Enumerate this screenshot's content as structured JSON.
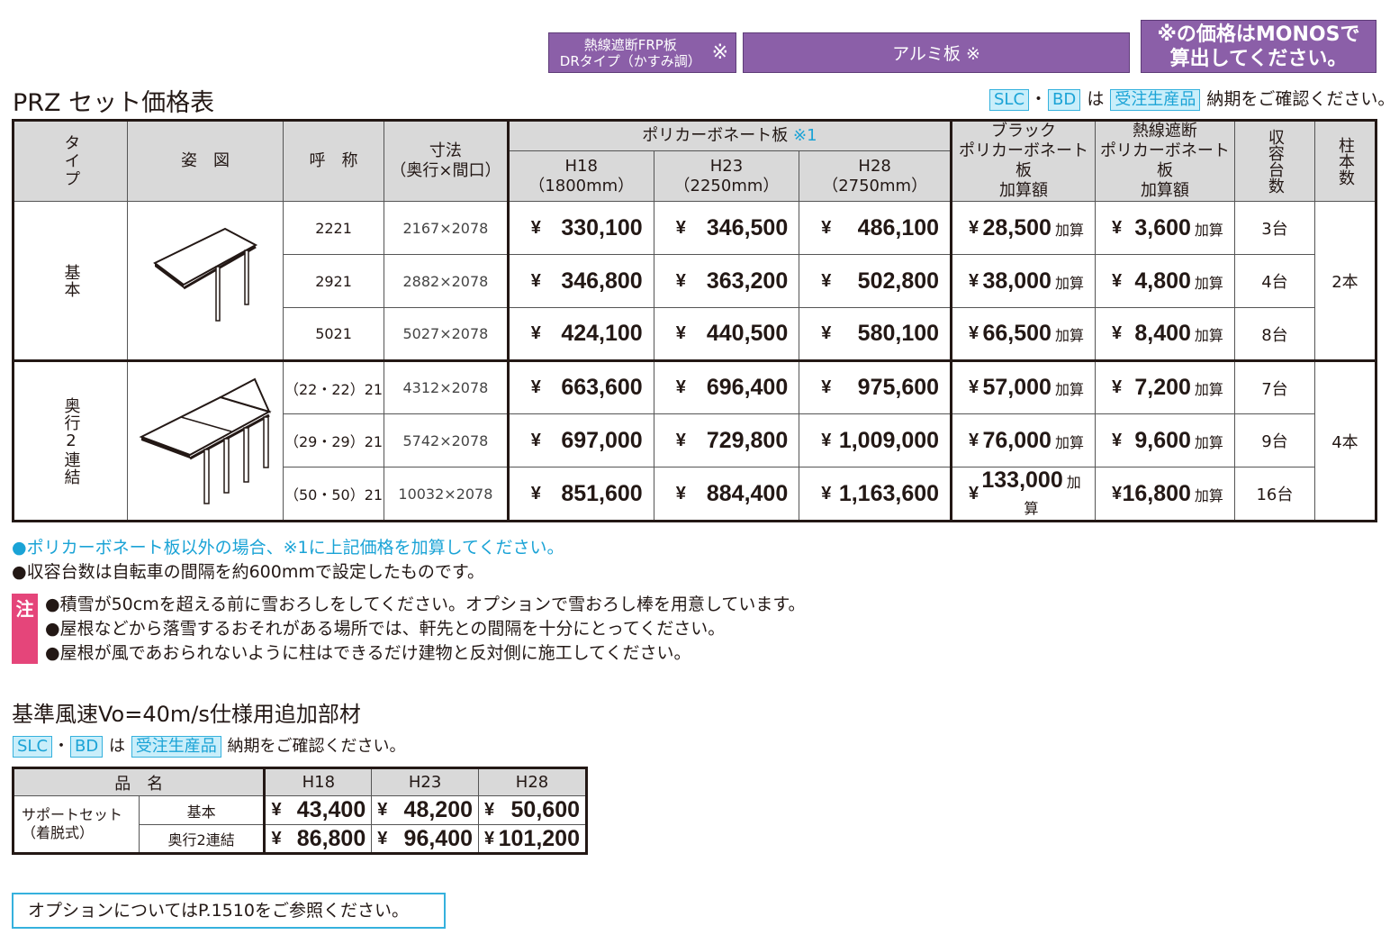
{
  "top_boxes": {
    "box1_line1": "熱線遮断FRP板",
    "box1_line2": "DRタイプ（かすみ調）",
    "box1_mark": "※",
    "box2": "アルミ板 ※",
    "box3_line1": "※の価格はMONOSで",
    "box3_line2": "算出してください。"
  },
  "title": "PRZ セット価格表",
  "notice": {
    "tag1": "SLC",
    "dot": "・",
    "tag2": "BD",
    "wa": "は",
    "tag3": "受注生産品",
    "text": "納期をご確認ください。"
  },
  "table": {
    "headers": {
      "type": "タイプ",
      "figure": "姿　図",
      "name": "呼　称",
      "dim_line1": "寸法",
      "dim_line2": "（奥行×間口）",
      "poly": "ポリカーボネート板",
      "poly_mark": "※1",
      "h18": "H18",
      "h18_mm": "（1800mm）",
      "h23": "H23",
      "h23_mm": "（2250mm）",
      "h28": "H28",
      "h28_mm": "（2750mm）",
      "black_l1": "ブラック",
      "black_l2": "ポリカーボネート板",
      "black_l3": "加算額",
      "heat_l1": "熱線遮断",
      "heat_l2": "ポリカーボネート板",
      "heat_l3": "加算額",
      "capacity": "収容台数",
      "posts": "柱本数"
    },
    "yen": "¥",
    "add": "加算",
    "groups": [
      {
        "type": "基本",
        "posts": "2本",
        "rows": [
          {
            "name": "2221",
            "dim": "2167×2078",
            "h18": "330,100",
            "h23": "346,500",
            "h28": "486,100",
            "black": "28,500",
            "heat": "3,600",
            "cap": "3台"
          },
          {
            "name": "2921",
            "dim": "2882×2078",
            "h18": "346,800",
            "h23": "363,200",
            "h28": "502,800",
            "black": "38,000",
            "heat": "4,800",
            "cap": "4台"
          },
          {
            "name": "5021",
            "dim": "5027×2078",
            "h18": "424,100",
            "h23": "440,500",
            "h28": "580,100",
            "black": "66,500",
            "heat": "8,400",
            "cap": "8台"
          }
        ]
      },
      {
        "type": "奥行2連結",
        "posts": "4本",
        "rows": [
          {
            "name": "（22・22）21",
            "dim": "4312×2078",
            "h18": "663,600",
            "h23": "696,400",
            "h28": "975,600",
            "black": "57,000",
            "heat": "7,200",
            "cap": "7台"
          },
          {
            "name": "（29・29）21",
            "dim": "5742×2078",
            "h18": "697,000",
            "h23": "729,800",
            "h28": "1,009,000",
            "black": "76,000",
            "heat": "9,600",
            "cap": "9台"
          },
          {
            "name": "（50・50）21",
            "dim": "10032×2078",
            "h18": "851,600",
            "h23": "884,400",
            "h28": "1,163,600",
            "black": "133,000",
            "heat": "16,800",
            "cap": "16台"
          }
        ]
      }
    ]
  },
  "notes": {
    "blue": "●ポリカーボネート板以外の場合、※1に上記価格を加算してください。",
    "black": "●収容台数は自転車の間隔を約600mmで設定したものです。"
  },
  "caution": {
    "label": "注",
    "items": [
      "●積雪が50cmを超える前に雪おろしをしてください。オプションで雪おろし棒を用意しています。",
      "●屋根などから落雪するおそれがある場所では、軒先との間隔を十分にとってください。",
      "●屋根が風であおられないように柱はできるだけ建物と反対側に施工してください。"
    ]
  },
  "support": {
    "title": "基準風速Vo=40m/s仕様用追加部材",
    "header_name": "品　名",
    "h18": "H18",
    "h23": "H23",
    "h28": "H28",
    "item_l1": "サポートセット",
    "item_l2": "（着脱式）",
    "rows": [
      {
        "type": "基本",
        "h18": "43,400",
        "h23": "48,200",
        "h28": "50,600"
      },
      {
        "type": "奥行2連結",
        "h18": "86,800",
        "h23": "96,400",
        "h28": "101,200"
      }
    ]
  },
  "option_ref": "オプションについてはP.1510をご参照ください。",
  "colors": {
    "purple": "#8b5fa8",
    "blue": "#1aa3d6",
    "pink": "#e5457a",
    "header_gray": "#d9d9d9"
  }
}
